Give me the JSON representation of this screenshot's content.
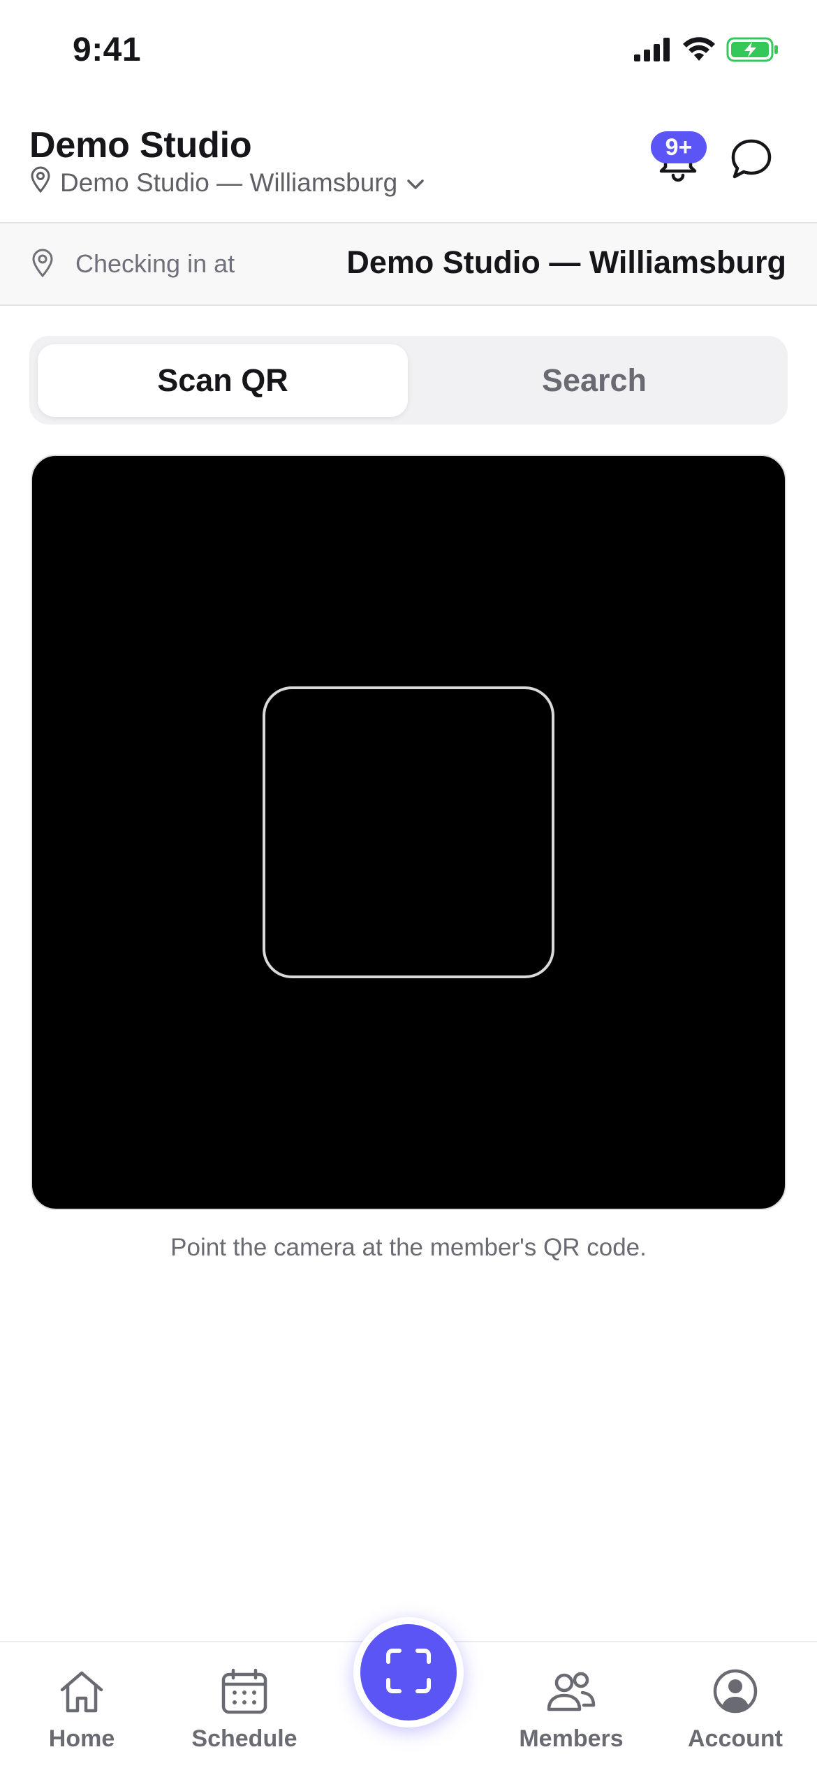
{
  "status_bar": {
    "time": "9:41"
  },
  "header": {
    "studio_name": "Demo Studio",
    "location": "Demo Studio — Williamsburg",
    "notification_badge": "9+"
  },
  "banner": {
    "label": "Checking in at",
    "value": "Demo Studio — Williamsburg"
  },
  "segment": {
    "tabs": [
      {
        "label": "Scan QR",
        "selected": true
      },
      {
        "label": "Search",
        "selected": false
      }
    ]
  },
  "scanner": {
    "hint": "Point the camera at the member's QR code."
  },
  "tabbar": {
    "items": [
      {
        "label": "Home",
        "icon": "home-icon"
      },
      {
        "label": "Schedule",
        "icon": "calendar-icon"
      },
      {
        "label": "",
        "icon": "scan-icon"
      },
      {
        "label": "Members",
        "icon": "members-icon"
      },
      {
        "label": "Account",
        "icon": "account-icon"
      }
    ]
  },
  "colors": {
    "accent": "#5b55f5",
    "text": "#16161a",
    "muted": "#6a6a73",
    "camera_bg": "#000000",
    "battery_green": "#34c759"
  }
}
